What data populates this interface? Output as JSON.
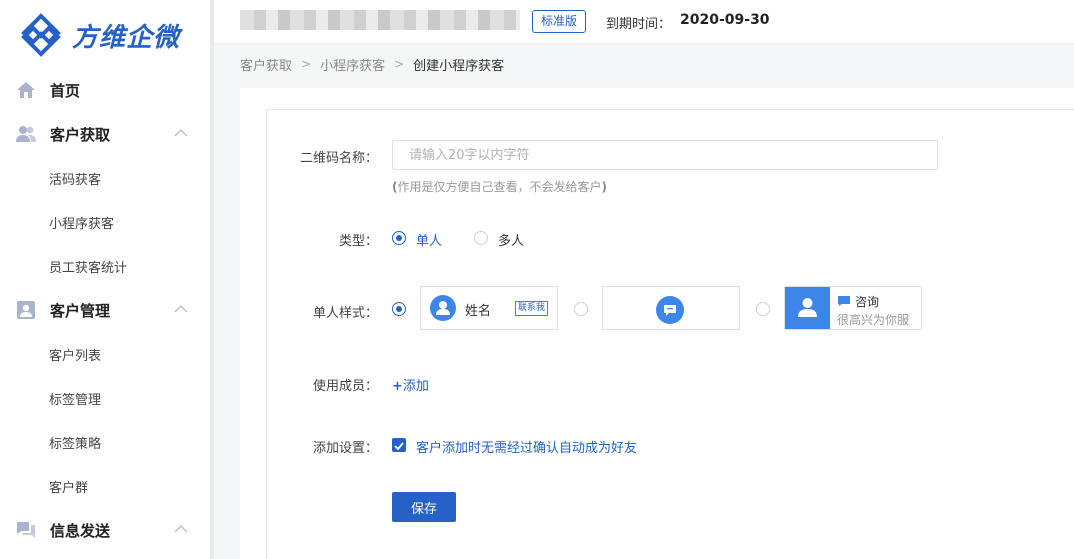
{
  "app": {
    "logo_text": "方维企微"
  },
  "colors": {
    "accent": "#2561c6",
    "avatar_blue": "#3d86e8"
  },
  "sidebar": {
    "groups": [
      {
        "label": "首页",
        "icon": "home-icon"
      },
      {
        "label": "客户获取",
        "icon": "users-icon",
        "expanded": true,
        "items": [
          "活码获客",
          "小程序获客",
          "员工获客统计"
        ]
      },
      {
        "label": "客户管理",
        "icon": "contact-card-icon",
        "expanded": true,
        "items": [
          "客户列表",
          "标签管理",
          "标签策略",
          "客户群"
        ]
      },
      {
        "label": "信息发送",
        "icon": "chat-icon",
        "expanded": true
      }
    ]
  },
  "topbar": {
    "edition": "标准版",
    "expiry_label": "到期时间：",
    "expiry_date": "2020-09-30"
  },
  "breadcrumb": [
    "客户获取",
    "小程序获客",
    "创建小程序获客"
  ],
  "form": {
    "name_label": "二维码名称：",
    "name_placeholder": "请输入20字以内字符",
    "name_hint": "作用是仅方便自己查看，不会发给客户",
    "type_label": "类型：",
    "type_options": [
      "单人",
      "多人"
    ],
    "type_selected": "单人",
    "style_label": "单人样式：",
    "style_options": {
      "style1_name": "姓名",
      "style1_tag": "联系我",
      "style3_title": "咨询",
      "style3_subtitle": "很高兴为你服"
    },
    "style_selected_index": 0,
    "members_label": "使用成员：",
    "members_add": "添加",
    "add_settings_label": "添加设置：",
    "auto_friend_text": "客户添加时无需经过确认自动成为好友",
    "auto_friend_checked": true,
    "save_label": "保存"
  }
}
